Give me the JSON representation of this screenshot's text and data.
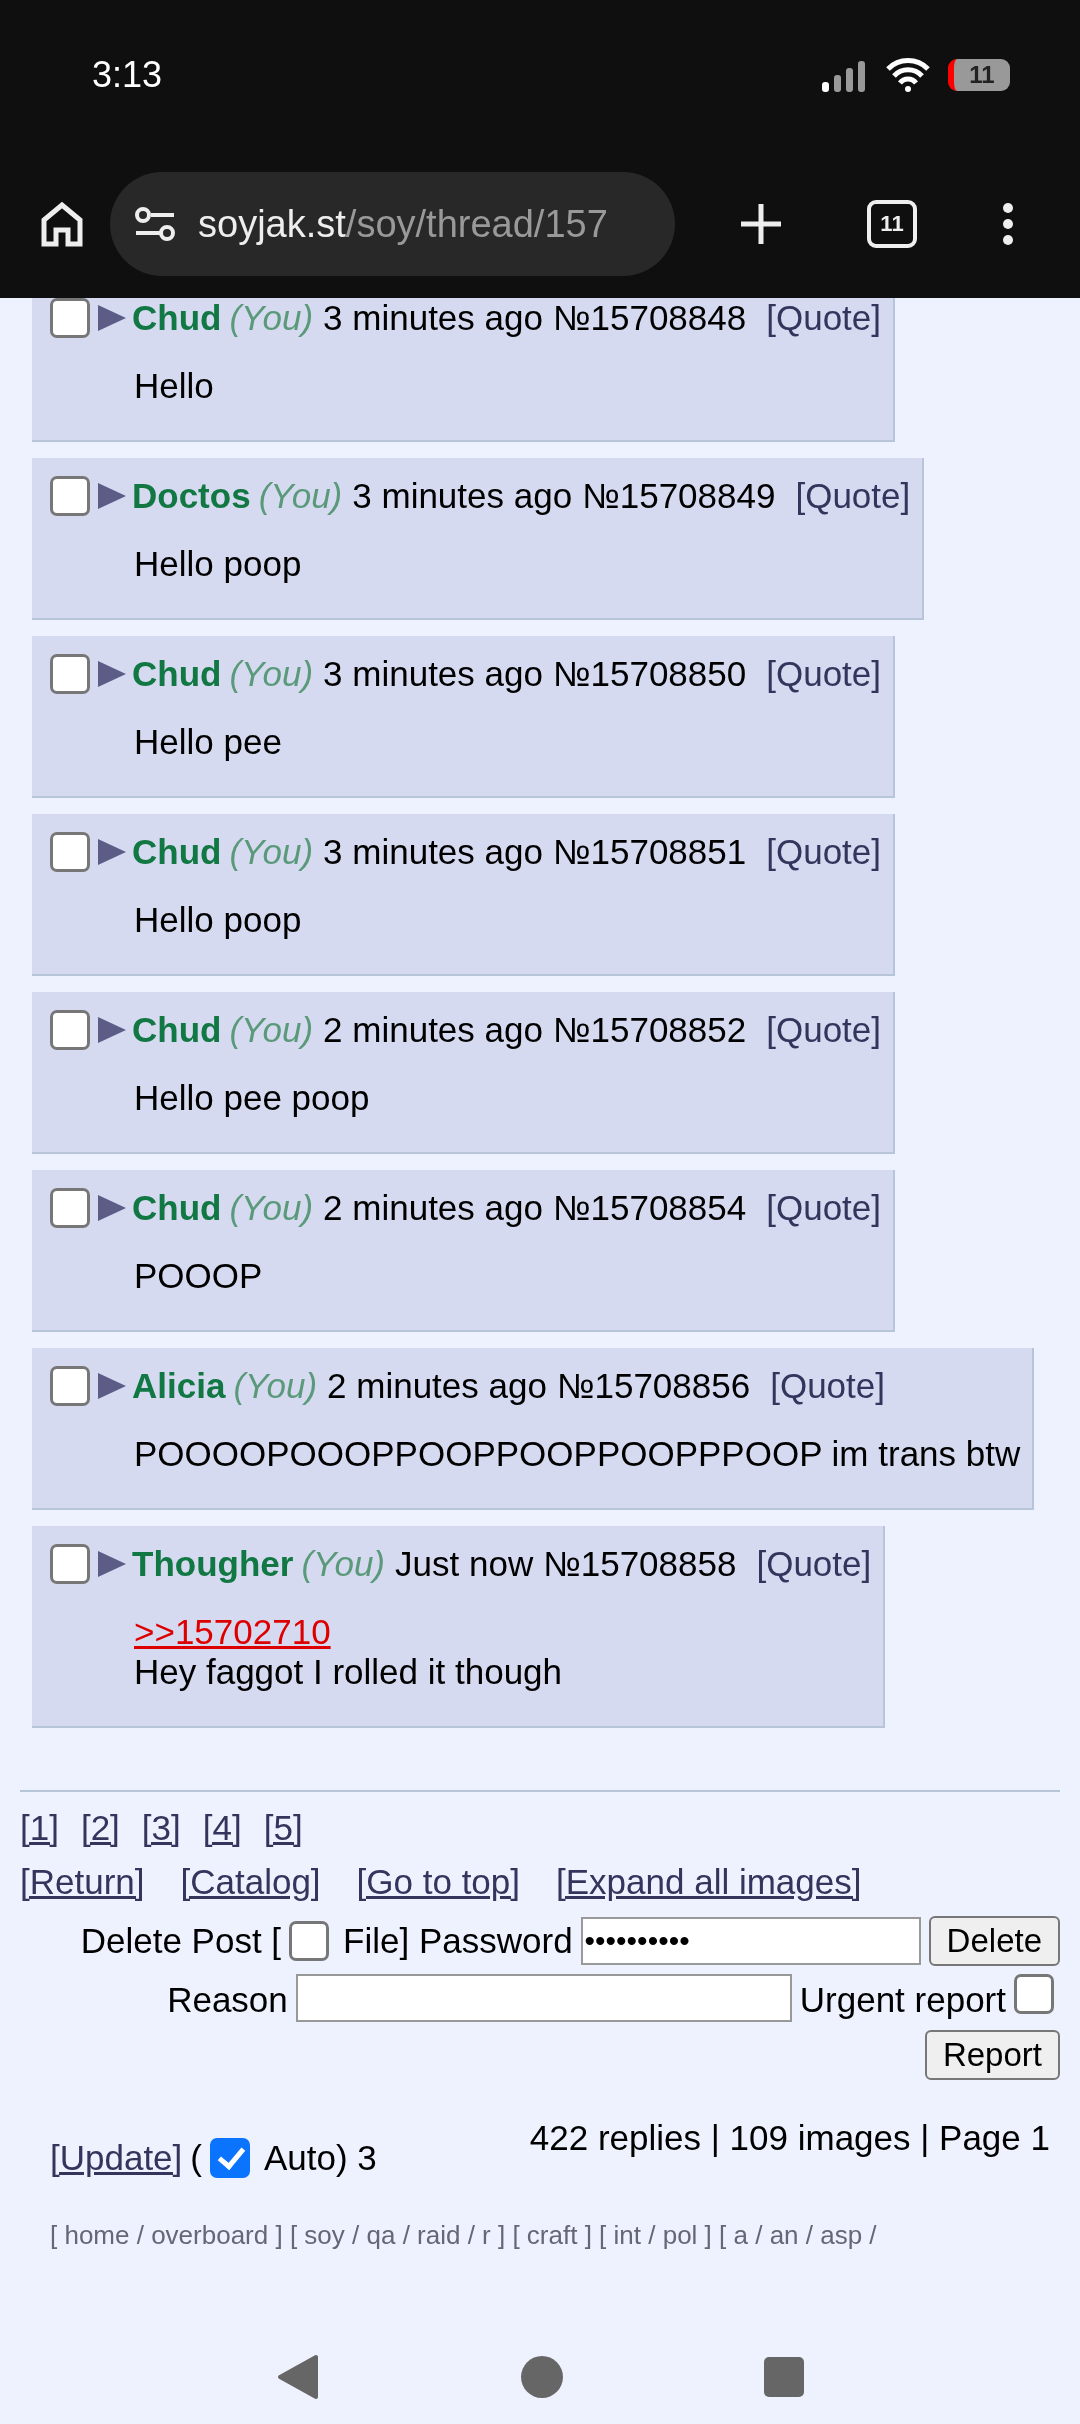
{
  "status_bar": {
    "time": "3:13",
    "battery": "11"
  },
  "browser": {
    "host": "soyjak.st",
    "path": "/soy/thread/157",
    "tab_count": "11"
  },
  "posts": [
    {
      "checked": false,
      "name": "Chud",
      "you": "(You)",
      "time": "3 minutes ago",
      "number": "№15708848",
      "quote": "[Quote]",
      "body": [
        {
          "kind": "text",
          "text": "Hello"
        }
      ]
    },
    {
      "checked": false,
      "name": "Doctos",
      "you": "(You)",
      "time": "3 minutes ago",
      "number": "№15708849",
      "quote": "[Quote]",
      "body": [
        {
          "kind": "text",
          "text": "Hello poop"
        }
      ]
    },
    {
      "checked": false,
      "name": "Chud",
      "you": "(You)",
      "time": "3 minutes ago",
      "number": "№15708850",
      "quote": "[Quote]",
      "body": [
        {
          "kind": "text",
          "text": "Hello pee"
        }
      ]
    },
    {
      "checked": false,
      "name": "Chud",
      "you": "(You)",
      "time": "3 minutes ago",
      "number": "№15708851",
      "quote": "[Quote]",
      "body": [
        {
          "kind": "text",
          "text": "Hello poop"
        }
      ]
    },
    {
      "checked": false,
      "name": "Chud",
      "you": "(You)",
      "time": "2 minutes ago",
      "number": "№15708852",
      "quote": "[Quote]",
      "body": [
        {
          "kind": "text",
          "text": "Hello pee poop"
        }
      ]
    },
    {
      "checked": false,
      "name": "Chud",
      "you": "(You)",
      "time": "2 minutes ago",
      "number": "№15708854",
      "quote": "[Quote]",
      "body": [
        {
          "kind": "text",
          "text": "POOOP"
        }
      ]
    },
    {
      "checked": false,
      "name": "Alicia",
      "you": "(You)",
      "time": "2 minutes ago",
      "number": "№15708856",
      "quote": "[Quote]",
      "body": [
        {
          "kind": "text",
          "text": "POOOOPOOOPPOOPPOOPPOOPPPOOP im trans btw"
        }
      ]
    },
    {
      "checked": false,
      "name": "Thougher",
      "you": "(You)",
      "time": "Just now",
      "number": "№15708858",
      "quote": "[Quote]",
      "body": [
        {
          "kind": "reply",
          "text": ">>15702710"
        },
        {
          "kind": "text",
          "text": "Hey faggot I rolled it though"
        }
      ]
    }
  ],
  "pages": [
    "[1]",
    "[2]",
    "[3]",
    "[4]",
    "[5]"
  ],
  "nav_links": [
    "[Return]",
    "[Catalog]",
    "[Go to top]",
    "[Expand all images]"
  ],
  "delete_form": {
    "label_before": "Delete Post [",
    "file_checked": false,
    "label_after": "File] Password",
    "password": "••••••••••",
    "button": "Delete"
  },
  "report_form": {
    "label": "Reason",
    "urgent_label": "Urgent report",
    "urgent_checked": false,
    "button": "Report"
  },
  "update": {
    "link": "[Update]",
    "open": "(",
    "auto_checked": true,
    "auto_label": "Auto) 3"
  },
  "stats": "422 replies | 109 images | Page 1",
  "boards": "[ home / overboard ] [ soy / qa / raid / r ] [ craft ] [ int / pol ] [ a / an / asp /"
}
